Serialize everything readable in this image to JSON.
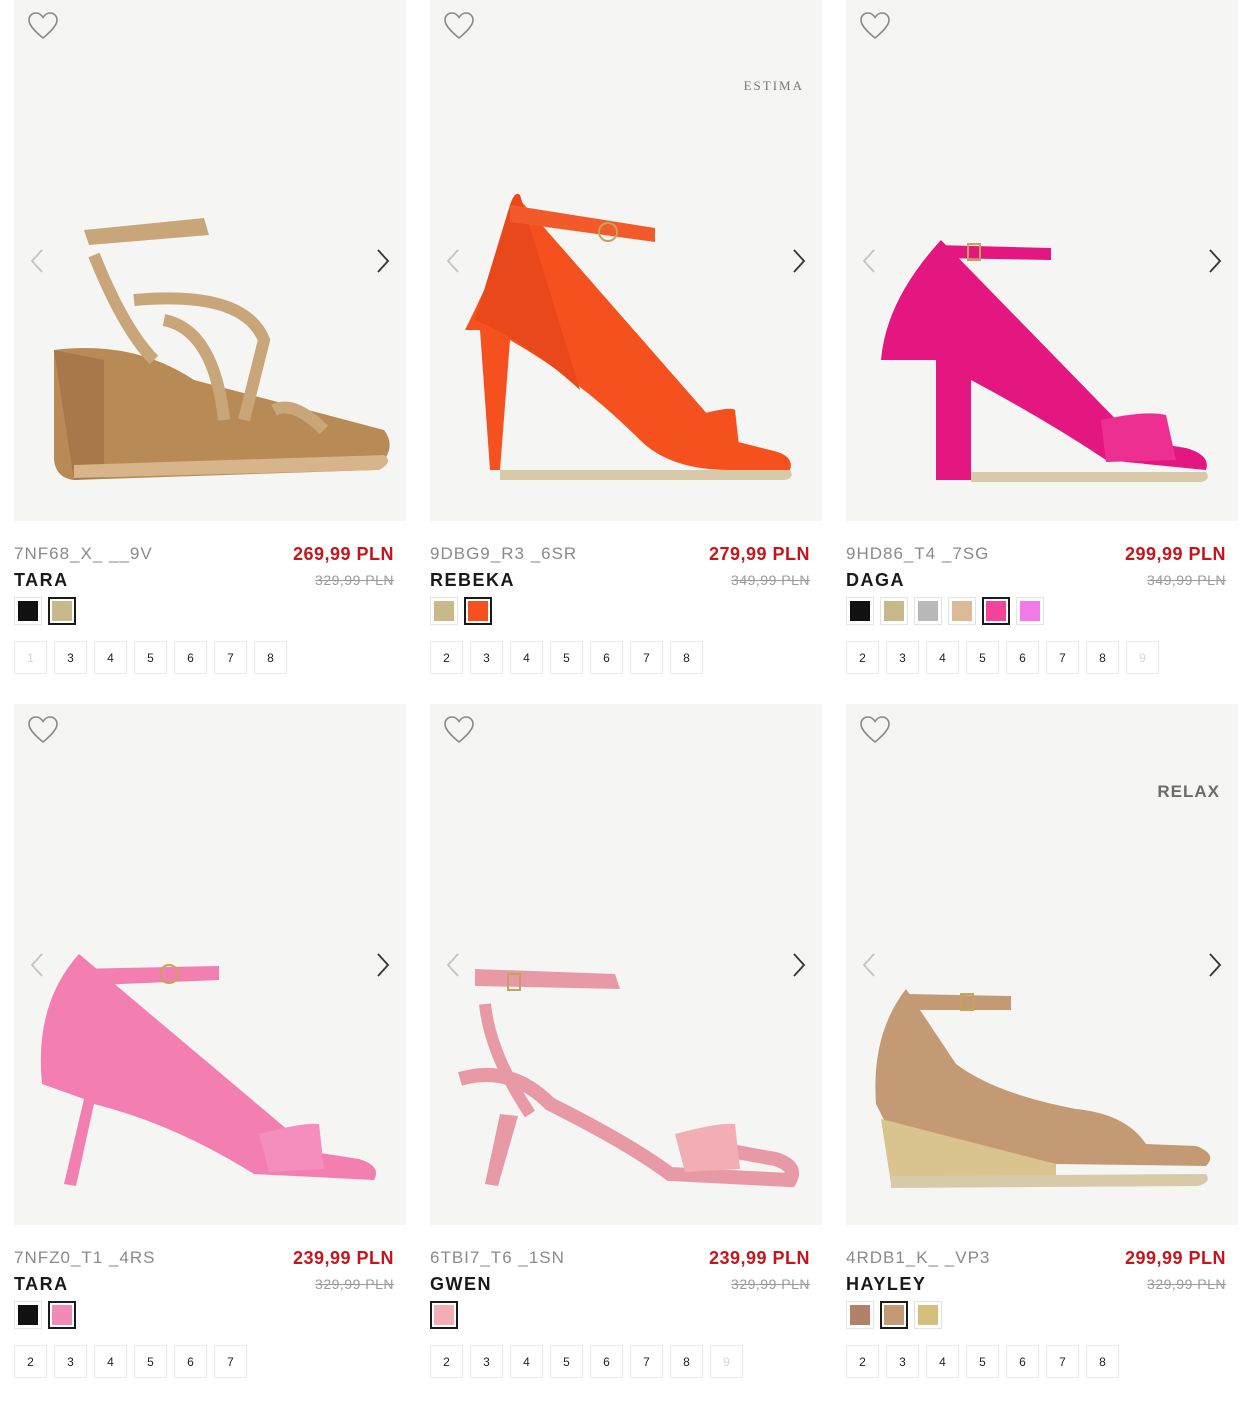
{
  "products": [
    {
      "code": "7NF68_X_ __9V",
      "name": "TARA",
      "price": "269,99 PLN",
      "old_price": "329,99 PLN",
      "brand_tag": "",
      "colors": [
        "#111111",
        "#c8b98a"
      ],
      "selected_color": 1,
      "sizes": [
        "1",
        "3",
        "4",
        "5",
        "6",
        "7",
        "8"
      ],
      "unavailable_sizes": [
        "1"
      ]
    },
    {
      "code": "9DBG9_R3 _6SR",
      "name": "REBEKA",
      "price": "279,99 PLN",
      "old_price": "349,99 PLN",
      "brand_tag": "ESTIMA",
      "colors": [
        "#c8b98a",
        "#f4511e"
      ],
      "selected_color": 1,
      "sizes": [
        "2",
        "3",
        "4",
        "5",
        "6",
        "7",
        "8"
      ],
      "unavailable_sizes": []
    },
    {
      "code": "9HD86_T4 _7SG",
      "name": "DAGA",
      "price": "299,99 PLN",
      "old_price": "349,99 PLN",
      "brand_tag": "",
      "colors": [
        "#111111",
        "#c8b98a",
        "#b9b9b9",
        "#d9bb98",
        "#f2449a",
        "#f27ae8"
      ],
      "selected_color": 4,
      "sizes": [
        "2",
        "3",
        "4",
        "5",
        "6",
        "7",
        "8",
        "9"
      ],
      "unavailable_sizes": [
        "9"
      ]
    },
    {
      "code": "7NFZ0_T1 _4RS",
      "name": "TARA",
      "price": "239,99 PLN",
      "old_price": "329,99 PLN",
      "brand_tag": "",
      "colors": [
        "#111111",
        "#f28ab8"
      ],
      "selected_color": 1,
      "sizes": [
        "2",
        "3",
        "4",
        "5",
        "6",
        "7"
      ],
      "unavailable_sizes": []
    },
    {
      "code": "6TBI7_T6 _1SN",
      "name": "GWEN",
      "price": "239,99 PLN",
      "old_price": "329,99 PLN",
      "brand_tag": "",
      "colors": [
        "#f2aeb4"
      ],
      "selected_color": 0,
      "sizes": [
        "2",
        "3",
        "4",
        "5",
        "6",
        "7",
        "8",
        "9"
      ],
      "unavailable_sizes": [
        "9"
      ]
    },
    {
      "code": "4RDB1_K_ _VP3",
      "name": "HAYLEY",
      "price": "299,99 PLN",
      "old_price": "329,99 PLN",
      "brand_tag": "RELAX",
      "colors": [
        "#b0826a",
        "#c39a74",
        "#d4bf7c"
      ],
      "selected_color": 1,
      "sizes": [
        "2",
        "3",
        "4",
        "5",
        "6",
        "7",
        "8"
      ],
      "unavailable_sizes": []
    }
  ],
  "icons": {
    "favorite": "heart-outline-icon",
    "prev": "chevron-left-icon",
    "next": "chevron-right-icon"
  },
  "colors": {
    "price": "#c4161c",
    "image_bg": "#f5f5f4"
  }
}
